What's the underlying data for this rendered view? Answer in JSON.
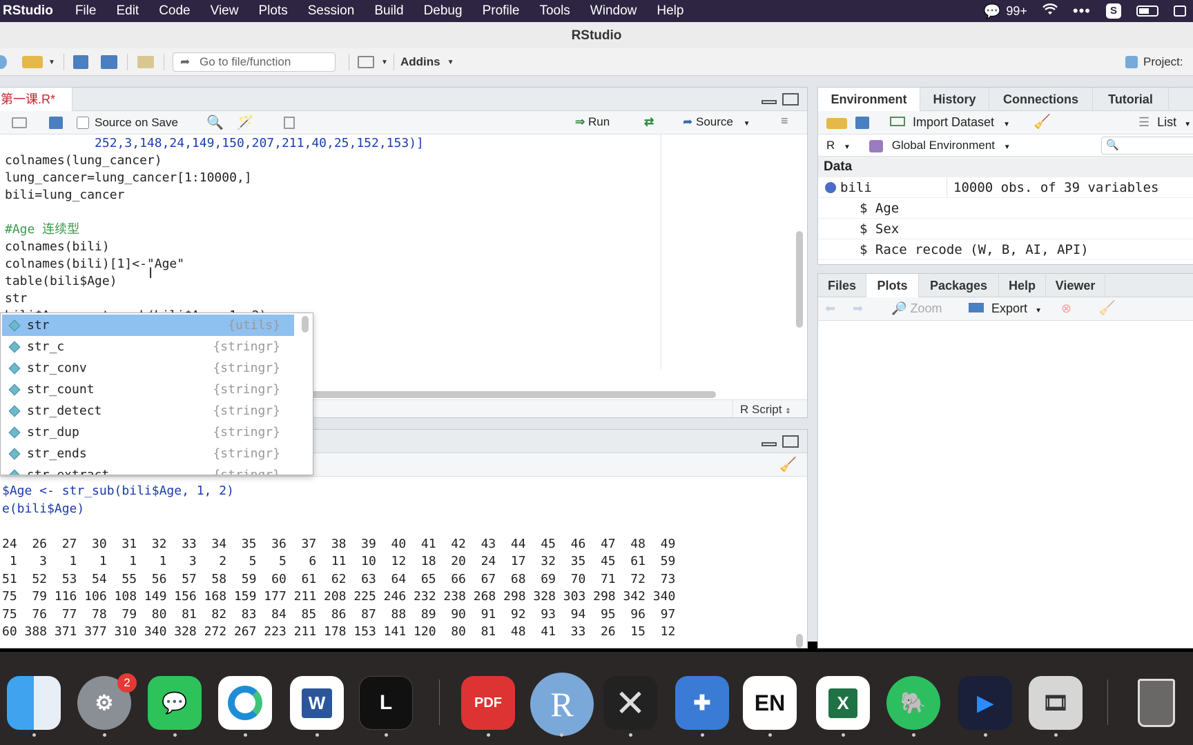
{
  "menubar": {
    "app": "RStudio",
    "items": [
      "File",
      "Edit",
      "Code",
      "View",
      "Plots",
      "Session",
      "Build",
      "Debug",
      "Profile",
      "Tools",
      "Window",
      "Help"
    ],
    "badge": "99+"
  },
  "window": {
    "title": "RStudio"
  },
  "toolbar": {
    "goto_placeholder": "Go to file/function",
    "addins": "Addins",
    "project": "Project:"
  },
  "editor": {
    "tab": "第一课.R*",
    "source_on_save": "Source on Save",
    "run": "Run",
    "source": "Source",
    "script_type": "R Script",
    "lines": [
      "            252,3,148,24,149,150,207,211,40,25,152,153)]",
      "colnames(lung_cancer)",
      "lung_cancer=lung_cancer[1:10000,]",
      "bili=lung_cancer",
      "",
      "#Age 连续型",
      "colnames(bili)",
      "colnames(bili)[1]<-\"Age\"",
      "table(bili$Age)",
      "str",
      "bili$Age <- str_sub(bili$Age, 1, 2)"
    ]
  },
  "autocomplete": [
    {
      "name": "str",
      "pkg": "{utils}"
    },
    {
      "name": "str_c",
      "pkg": "{stringr}"
    },
    {
      "name": "str_conv",
      "pkg": "{stringr}"
    },
    {
      "name": "str_count",
      "pkg": "{stringr}"
    },
    {
      "name": "str_detect",
      "pkg": "{stringr}"
    },
    {
      "name": "str_dup",
      "pkg": "{stringr}"
    },
    {
      "name": "str_ends",
      "pkg": "{stringr}"
    },
    {
      "name": "str_extract",
      "pkg": "{stringr}"
    }
  ],
  "console": {
    "lines": [
      "$Age <- str_sub(bili$Age, 1, 2)",
      "e(bili$Age)",
      "",
      "24  26  27  30  31  32  33  34  35  36  37  38  39  40  41  42  43  44  45  46  47  48  49",
      " 1   3   1   1   1   1   3   2   5   5   6  11  10  12  18  20  24  17  32  35  45  61  59",
      "51  52  53  54  55  56  57  58  59  60  61  62  63  64  65  66  67  68  69  70  71  72  73",
      "75  79 116 106 108 149 156 168 159 177 211 208 225 246 232 238 268 298 328 303 298 342 340",
      "75  76  77  78  79  80  81  82  83  84  85  86  87  88  89  90  91  92  93  94  95  96  97",
      "60 388 371 377 310 340 328 272 267 223 211 178 153 141 120  80  81  48  41  33  26  15  12"
    ]
  },
  "env": {
    "tabs": [
      "Environment",
      "History",
      "Connections",
      "Tutorial"
    ],
    "import": "Import Dataset",
    "list": "List",
    "lang": "R",
    "scope": "Global Environment",
    "section": "Data",
    "obj_name": "bili",
    "obj_desc": "10000 obs. of 39 variables",
    "vars": [
      "$ Age",
      "$ Sex",
      "$ Race recode (W, B, AI, API)"
    ]
  },
  "files": {
    "tabs": [
      "Files",
      "Plots",
      "Packages",
      "Help",
      "Viewer"
    ],
    "zoom": "Zoom",
    "export": "Export"
  },
  "dock": {
    "badge": "2",
    "icons": [
      "finder-icon",
      "system-settings-icon",
      "wechat-icon",
      "edge-icon",
      "word-icon",
      "lexi-icon",
      "pdf-expert-icon",
      "r-app-icon",
      "xquartz-icon",
      "tools-icon",
      "en-icon",
      "excel-icon",
      "evernote-icon",
      "video-player-icon",
      "photo-slideshow-icon",
      "trash-icon"
    ],
    "labels": {
      "pdf": "PDF",
      "r": "R",
      "en": "EN"
    }
  }
}
